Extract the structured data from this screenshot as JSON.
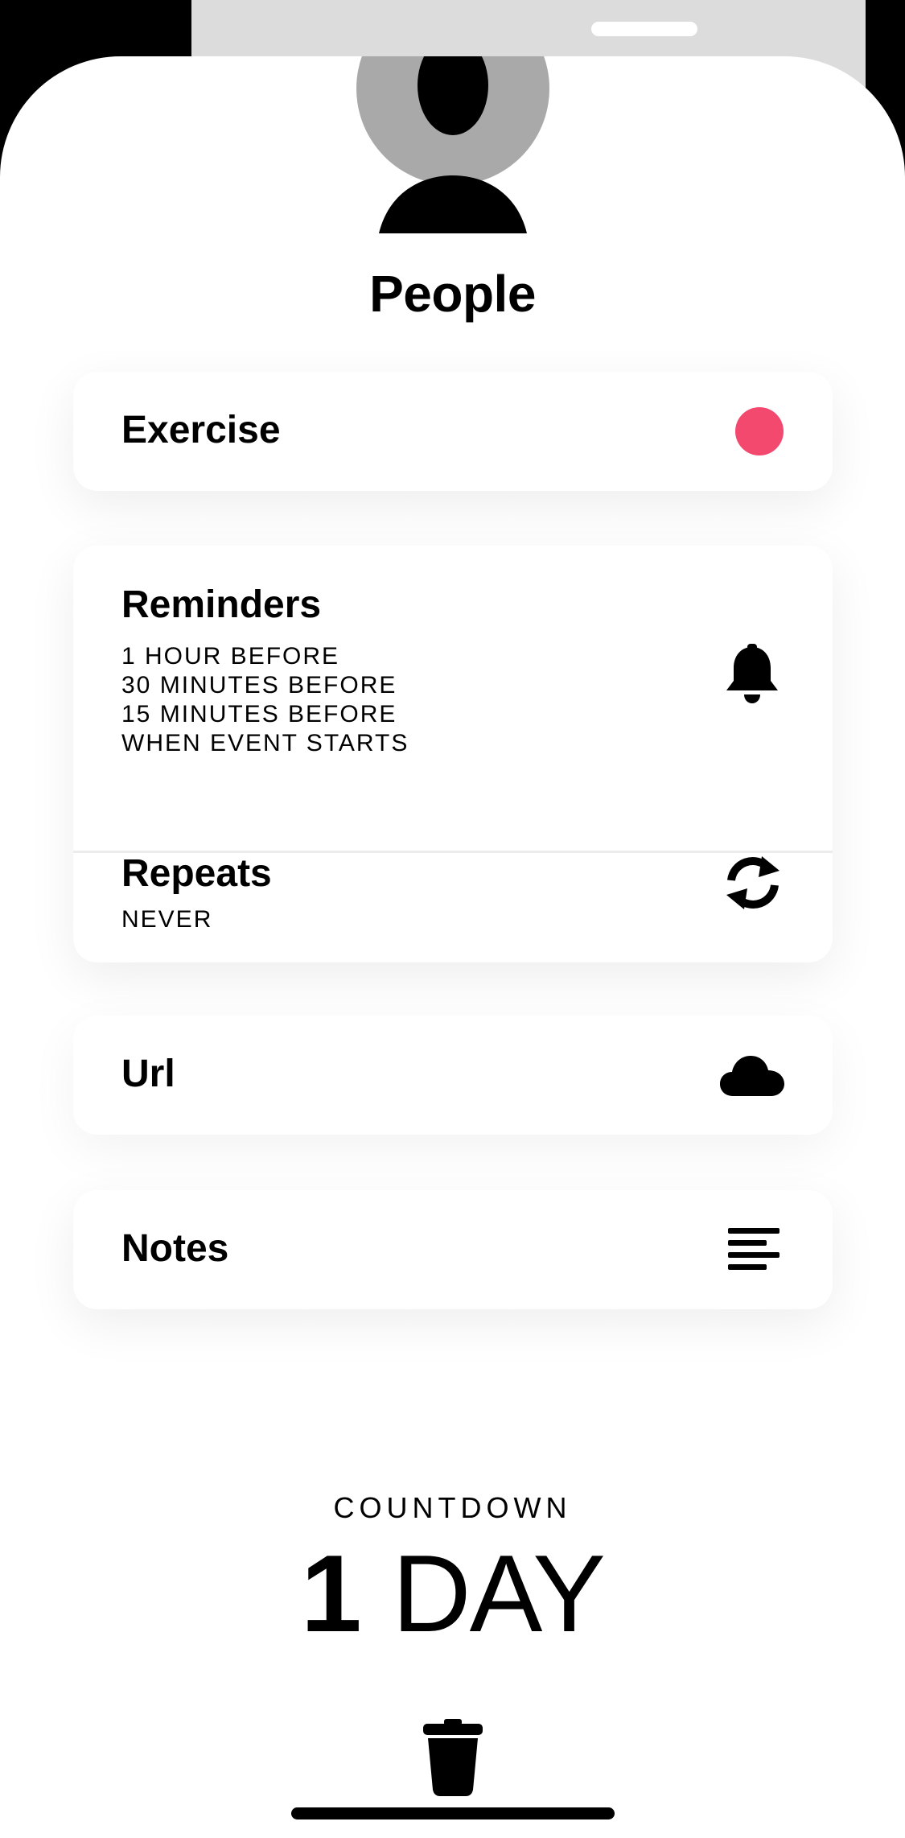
{
  "header": {
    "title": "People",
    "avatar_icon": "person-placeholder-icon"
  },
  "items": {
    "exercise": {
      "label": "Exercise",
      "color": "#F4496F",
      "icon": "color-dot"
    },
    "reminders": {
      "label": "Reminders",
      "lines": [
        "1 HOUR BEFORE",
        "30 MINUTES BEFORE",
        "15 MINUTES BEFORE",
        "WHEN EVENT STARTS"
      ],
      "icon": "bell-icon"
    },
    "repeats": {
      "label": "Repeats",
      "value": "NEVER",
      "icon": "repeat-icon"
    },
    "url": {
      "label": "Url",
      "icon": "cloud-icon"
    },
    "notes": {
      "label": "Notes",
      "icon": "text-align-icon"
    }
  },
  "countdown": {
    "label": "COUNTDOWN",
    "number": "1",
    "unit": "DAY"
  },
  "footer": {
    "delete_icon": "trash-icon"
  }
}
